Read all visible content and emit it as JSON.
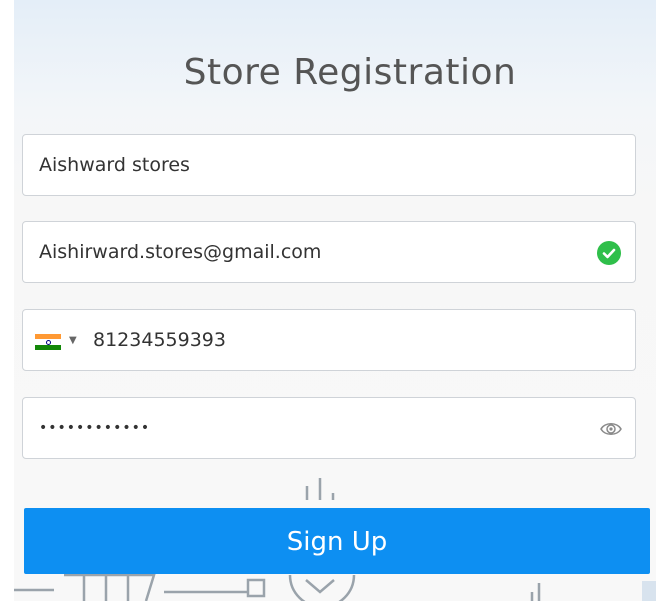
{
  "form": {
    "title": "Store Registration",
    "store_name": {
      "value": "Aishward stores"
    },
    "email": {
      "value": "Aishirward.stores@gmail.com",
      "status_icon": "check-circle-icon",
      "status_color": "#2fbf4a"
    },
    "phone": {
      "country_icon": "india-flag-icon",
      "value": "81234559393"
    },
    "password": {
      "value": "••••••••••••",
      "toggle_icon": "eye-icon"
    },
    "submit_label": "Sign Up"
  },
  "colors": {
    "accent": "#0d8ff2",
    "title_text": "#555555",
    "field_border": "#cfd3d8"
  }
}
